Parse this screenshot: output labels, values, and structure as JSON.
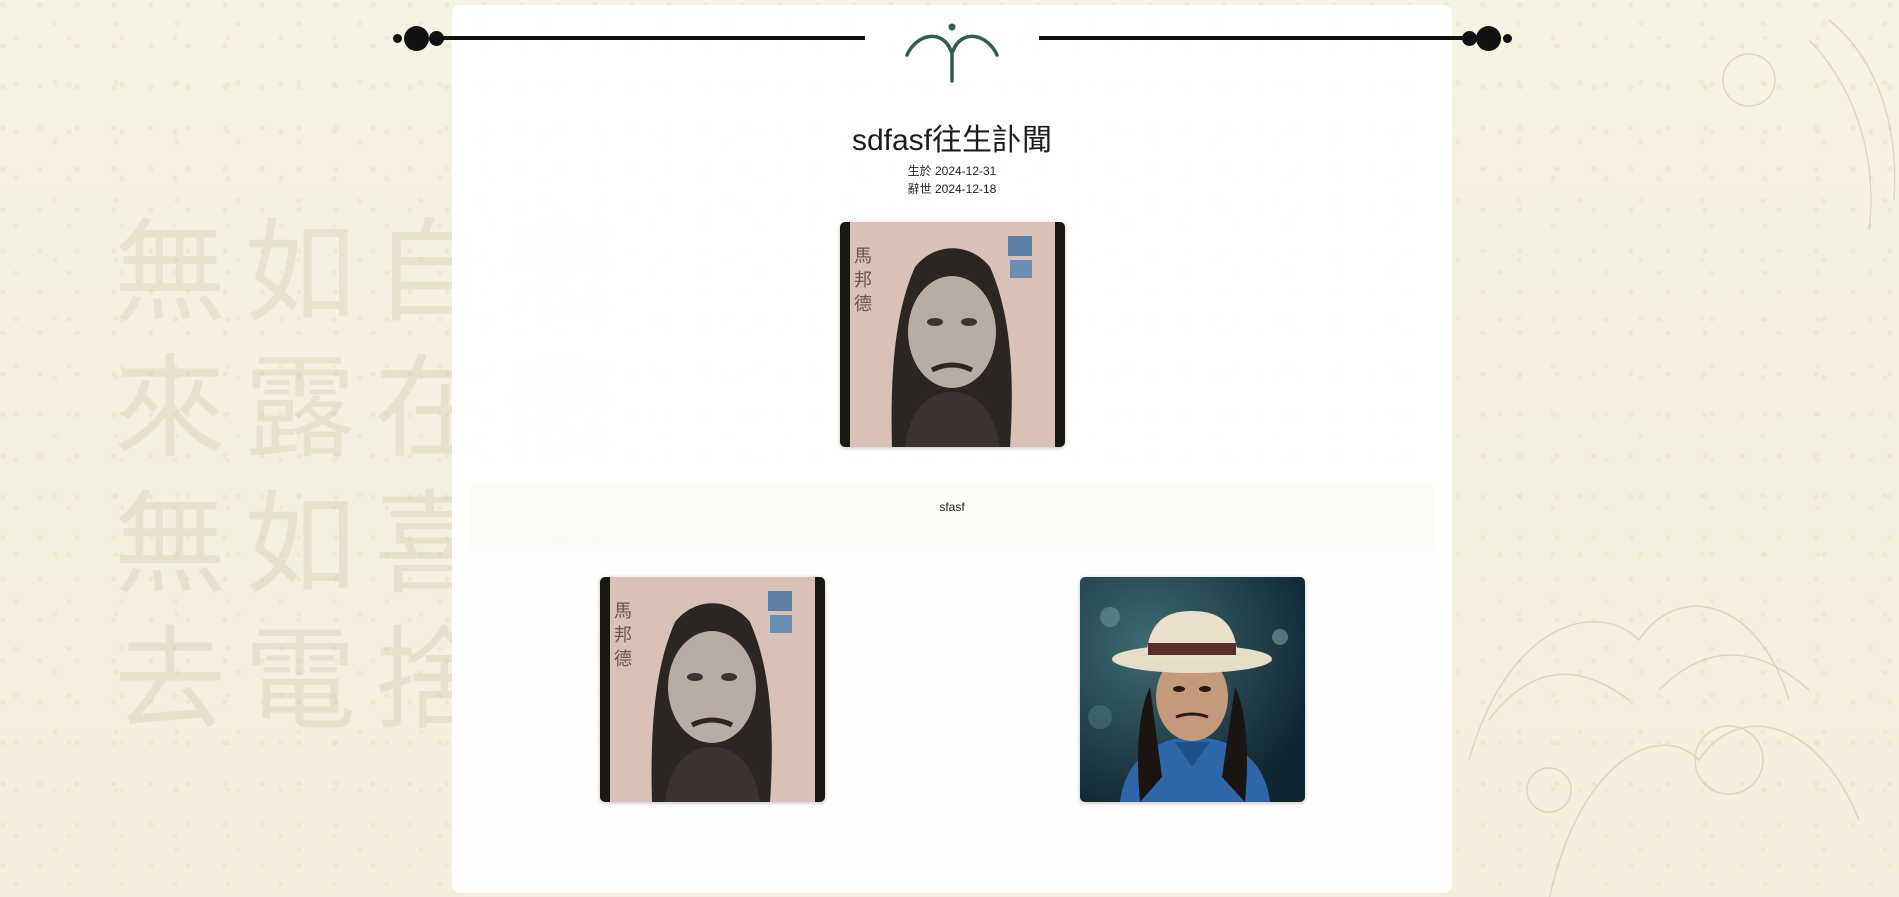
{
  "background": {
    "calligraphy": [
      "無",
      "如",
      "自",
      "悲",
      "來",
      "露",
      "在",
      "悲",
      "無",
      "如",
      "喜",
      "捨",
      "去",
      "電",
      "捨",
      "度"
    ]
  },
  "ornament": {
    "line_color": "#111111",
    "emblem_color": "#2f5c55",
    "emblem_icon": "lotus-sprout-icon"
  },
  "obituary": {
    "title": "sdfasf往生訃聞",
    "born": "生於 2024-12-31",
    "died": "辭世 2024-12-18",
    "message": "sfasf"
  },
  "photos": {
    "main": "portrait-photo",
    "gallery": [
      "portrait-photo",
      "hat-portrait-photo"
    ]
  }
}
